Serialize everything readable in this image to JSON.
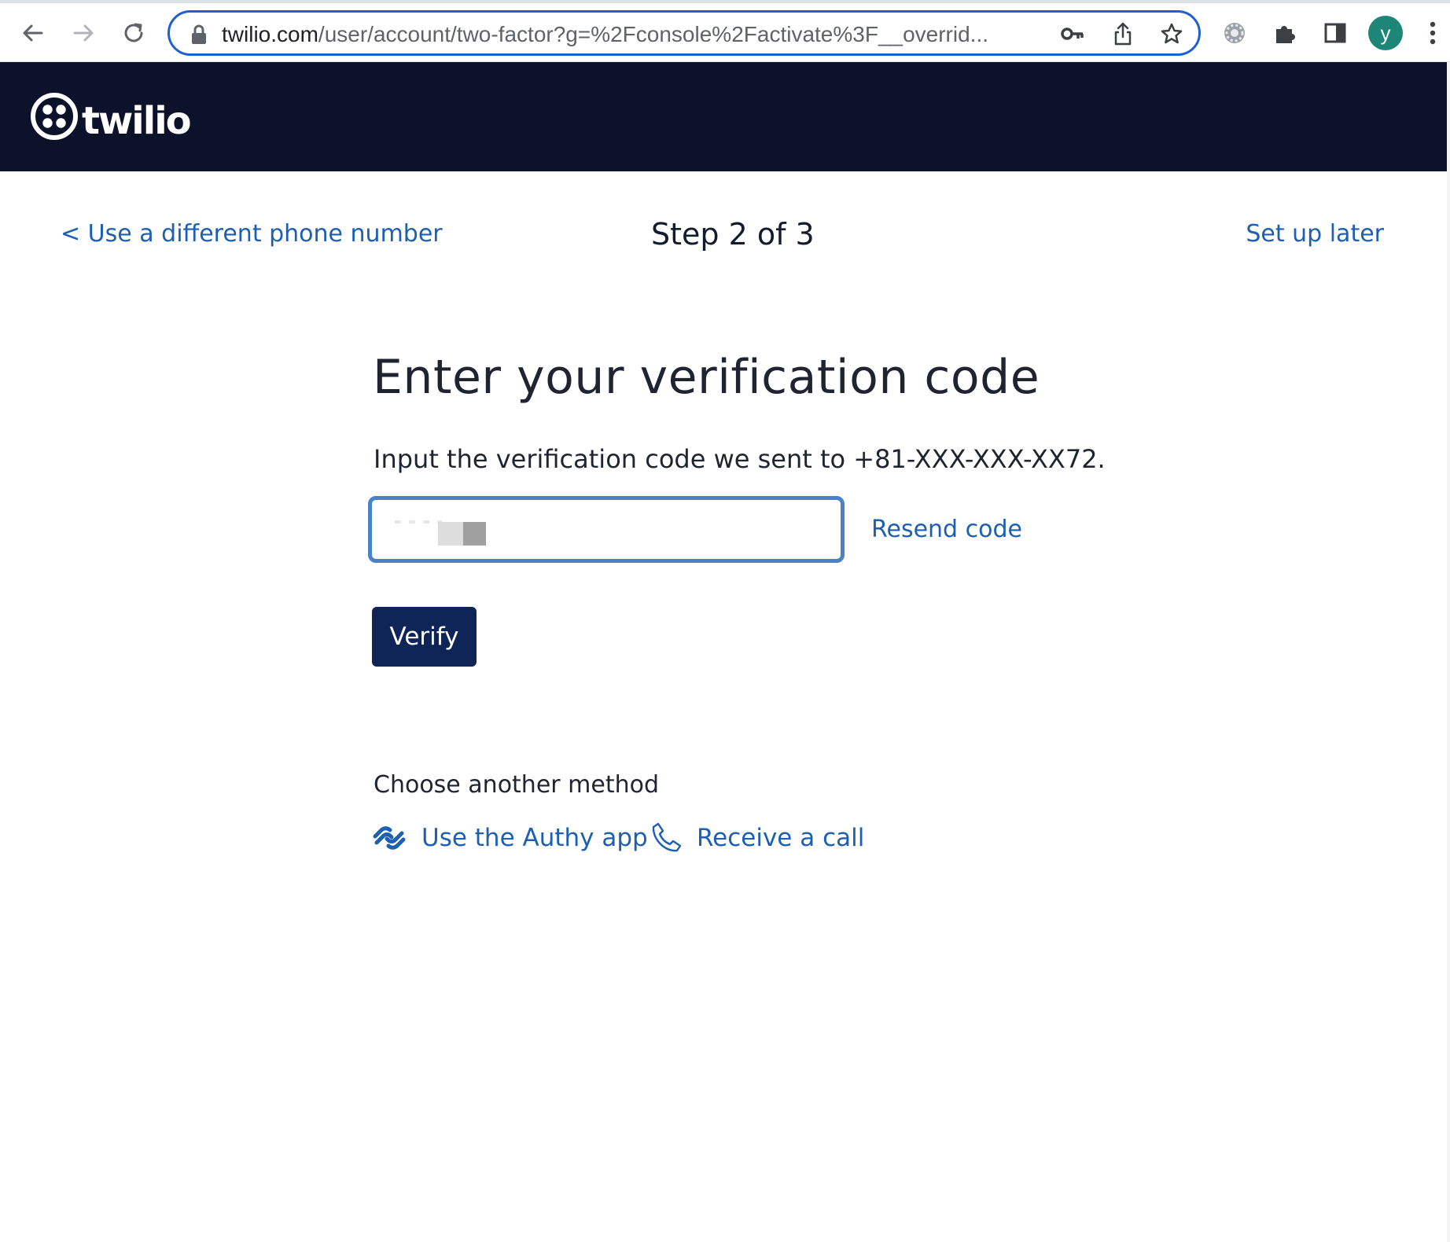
{
  "browser": {
    "url_host": "twilio.com",
    "url_path": "/user/account/two-factor?g=%2Fconsole%2Factivate%3F__overrid...",
    "profile_initial": "y"
  },
  "brand": {
    "name": "twilio"
  },
  "step_nav": {
    "back_label": "< Use a different phone number",
    "step_label": "Step 2 of 3",
    "later_label": "Set up later"
  },
  "form": {
    "title": "Enter your verification code",
    "instructions": "Input the verification code we sent to +81-XXX-XXX-XX72.",
    "code_value": "",
    "resend_label": "Resend code",
    "verify_label": "Verify"
  },
  "other_methods": {
    "heading": "Choose another method",
    "authy_label": "Use the Authy app",
    "call_label": "Receive a call"
  },
  "colors": {
    "brand_navy": "#0d122b",
    "button_navy": "#0f2557",
    "link_blue": "#1c5fb3",
    "focus_blue": "#4a82c9",
    "avatar_green": "#1e8676"
  }
}
